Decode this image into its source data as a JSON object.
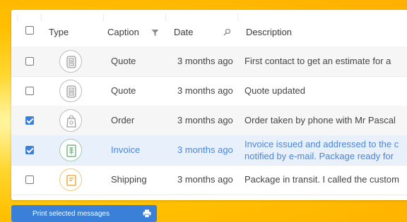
{
  "header": {
    "type": "Type",
    "caption": "Caption",
    "date": "Date",
    "description": "Description"
  },
  "rows": [
    {
      "caption": "Quote",
      "date": "3 months ago",
      "description": "First contact to get an estimate for a",
      "description2": "",
      "checked": false,
      "icon": "document-icon"
    },
    {
      "caption": "Quote",
      "date": "3 months ago",
      "description": "Quote updated",
      "description2": "",
      "checked": false,
      "icon": "document-icon"
    },
    {
      "caption": "Order",
      "date": "3 months ago",
      "description": "Order taken by phone with Mr Pascal",
      "description2": "",
      "checked": true,
      "icon": "order-bag-icon"
    },
    {
      "caption": "Invoice",
      "date": "3 months ago",
      "description": "Invoice issued and addressed to the c",
      "description2": "notified by e-mail. Package ready for",
      "checked": true,
      "icon": "invoice-icon"
    },
    {
      "caption": "Shipping",
      "date": "3 months ago",
      "description": "Package in transit. I called the custom",
      "description2": "",
      "checked": false,
      "icon": "shipping-icon"
    }
  ],
  "footer": {
    "print_label": "Print selected messages"
  },
  "colors": {
    "accent": "#3a7fd8",
    "selected_row": "#e8f0fc",
    "invoice_icon": "#5aa66a",
    "shipping_icon": "#e8a020"
  }
}
